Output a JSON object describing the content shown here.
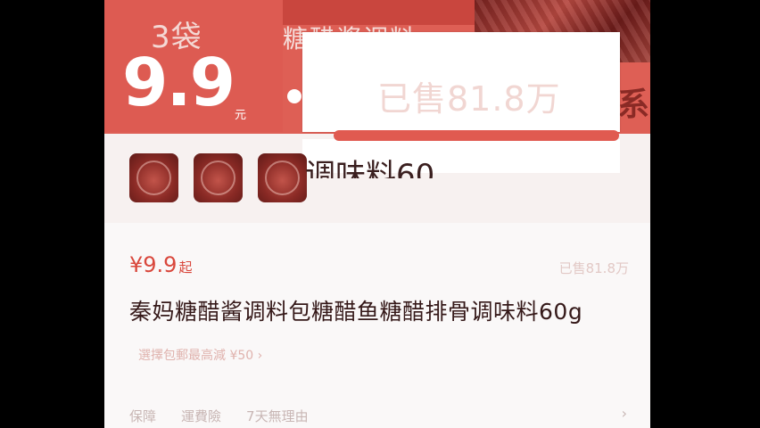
{
  "banner": {
    "bags_label": "3袋",
    "big_price": "9.9",
    "yuan": "元",
    "title_partial": "糖醋酱调料",
    "tail_char": "系"
  },
  "popup": {
    "sold_text": "已售81.8万"
  },
  "thumbnails": {
    "partial_title": "调味料60"
  },
  "product": {
    "price": "¥9.9",
    "price_suffix": "起",
    "sold": "已售81.8万",
    "title": "秦妈糖醋酱调料包糖醋鱼糖醋排骨调味料60g",
    "promo": "選擇包郵最高減 ¥50 ›"
  },
  "service": {
    "items": [
      "保障",
      "運費險",
      "7天無理由"
    ],
    "chevron": "›"
  },
  "colors": {
    "accent": "#de5f55",
    "price_red": "#d9473c"
  }
}
